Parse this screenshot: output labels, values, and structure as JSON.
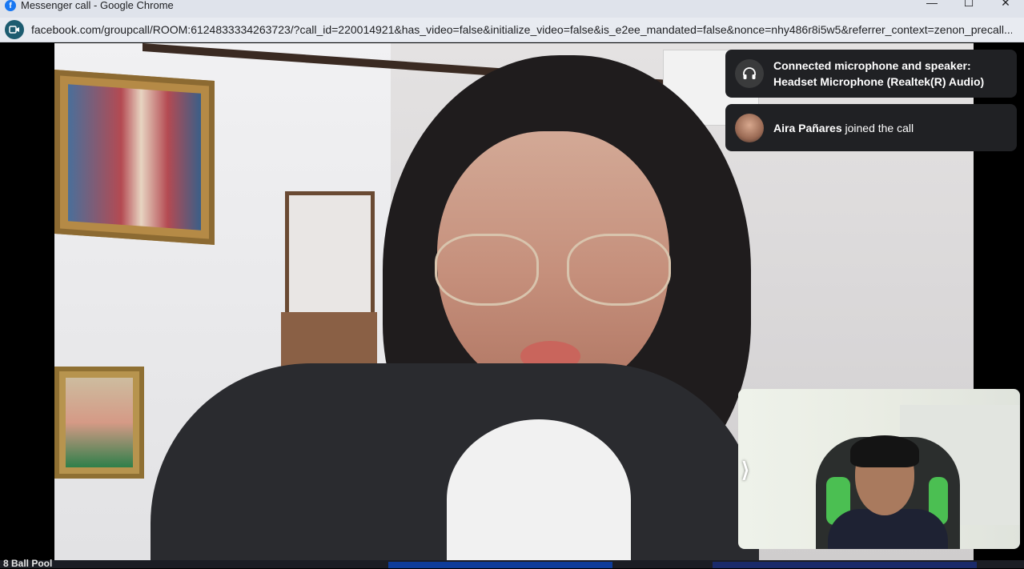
{
  "window": {
    "title": "Messenger call - Google Chrome",
    "controls": {
      "minimize": "—",
      "maximize": "☐",
      "close": "✕"
    }
  },
  "addressbar": {
    "url": "facebook.com/groupcall/ROOM:6124833334263723/?call_id=220014921&has_video=false&initialize_video=false&is_e2ee_mandated=false&nonce=nhy486r8i5w5&referrer_context=zenon_precall..."
  },
  "notifications": [
    {
      "icon": "headphones-icon",
      "text": "Connected microphone and speaker: Headset Microphone (Realtek(R) Audio)"
    },
    {
      "name": "Aira Pañares",
      "text": " joined the call"
    }
  ],
  "self_view": {
    "collapse_glyph": "⟩"
  },
  "taskbar": {
    "label": "8 Ball Pool"
  }
}
